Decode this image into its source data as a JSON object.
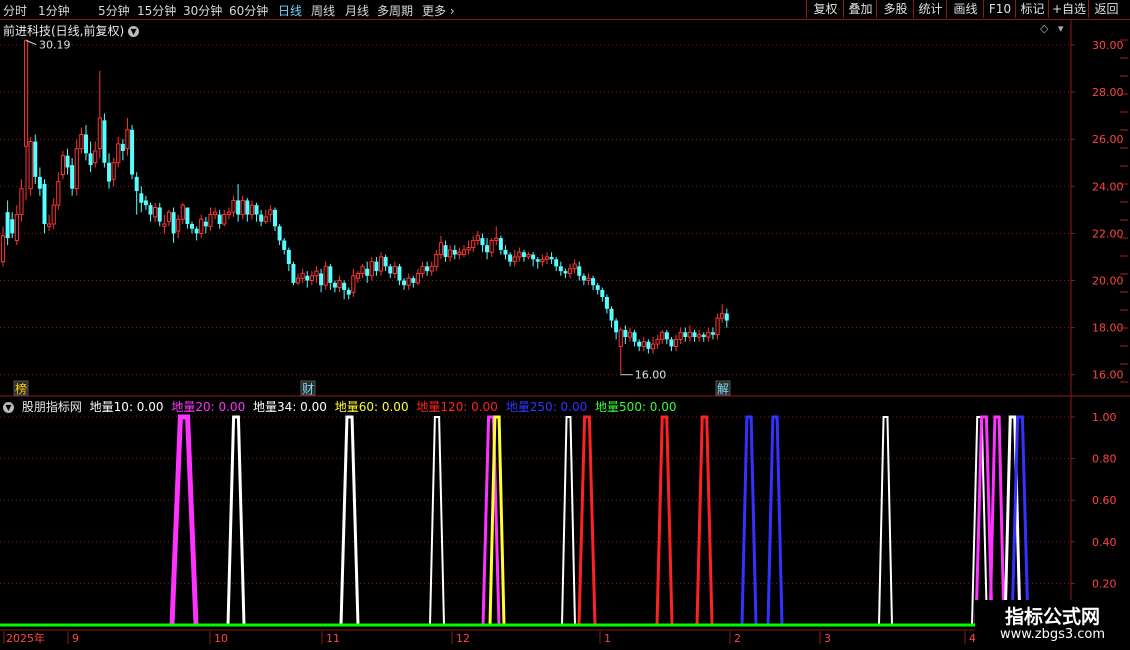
{
  "toolbar": {
    "periods": [
      "分时",
      "1分钟",
      "5分钟",
      "15分钟",
      "30分钟",
      "60分钟",
      "日线",
      "周线",
      "月线",
      "多周期",
      "更多"
    ],
    "active_period": "日线",
    "more_arrow": "chevron-right-icon",
    "right_buttons": [
      "复权",
      "叠加",
      "多股",
      "统计",
      "画线",
      "F10",
      "标记",
      "+自选",
      "返回"
    ]
  },
  "stock": {
    "title": "前进科技(日线,前复权)",
    "high_label": "30.19",
    "low_label": "16.00"
  },
  "events": [
    "榜",
    "财",
    "解"
  ],
  "price_axis": [
    "30.00",
    "28.00",
    "26.00",
    "24.00",
    "22.00",
    "20.00",
    "18.00",
    "16.00"
  ],
  "indicator": {
    "name": "股朋指标网",
    "series": [
      {
        "label": "地量10: 0.00",
        "color": "#ffffff"
      },
      {
        "label": "地量20: 0.00",
        "color": "#ff33ff"
      },
      {
        "label": "地量34: 0.00",
        "color": "#ffffff"
      },
      {
        "label": "地量60: 0.00",
        "color": "#ffff33"
      },
      {
        "label": "地量120: 0.00",
        "color": "#ff2222"
      },
      {
        "label": "地量250: 0.00",
        "color": "#3333ff"
      },
      {
        "label": "地量500: 0.00",
        "color": "#33ff33"
      }
    ],
    "axis": [
      "1.00",
      "0.80",
      "0.60",
      "0.40",
      "0.20"
    ]
  },
  "time_axis": [
    "2025年",
    "9",
    "10",
    "11",
    "12",
    "1",
    "2",
    "3",
    "4"
  ],
  "watermark": {
    "line1": "指标公式网",
    "line2": "www.zbgs3.com"
  },
  "colors": {
    "up": "#ff3333",
    "down": "#55ffff",
    "grid": "#8b1a1a",
    "base": "#00ff00"
  },
  "chart_data": {
    "type": "candlestick",
    "candles": [
      [
        20.8,
        21.9,
        20.6,
        22.3
      ],
      [
        22.9,
        21.8,
        21.5,
        23.4
      ],
      [
        22.6,
        22.0,
        21.8,
        22.9
      ],
      [
        21.7,
        22.8,
        21.5,
        23.2
      ],
      [
        22.8,
        23.9,
        22.5,
        24.3
      ],
      [
        25.7,
        30.2,
        23.4,
        30.19
      ],
      [
        23.9,
        25.9,
        23.6,
        26.1
      ],
      [
        25.9,
        24.4,
        24.1,
        26.2
      ],
      [
        24.4,
        23.9,
        23.6,
        24.8
      ],
      [
        24.1,
        22.4,
        22.0,
        24.3
      ],
      [
        22.3,
        22.4,
        22.1,
        22.8
      ],
      [
        22.4,
        23.2,
        22.2,
        23.5
      ],
      [
        23.2,
        24.2,
        23.0,
        24.6
      ],
      [
        24.5,
        25.3,
        24.3,
        25.5
      ],
      [
        25.3,
        24.8,
        24.5,
        25.6
      ],
      [
        24.9,
        23.9,
        23.6,
        25.2
      ],
      [
        23.9,
        25.6,
        23.6,
        26.0
      ],
      [
        25.6,
        26.2,
        25.4,
        26.5
      ],
      [
        26.2,
        25.4,
        25.1,
        26.6
      ],
      [
        25.4,
        24.9,
        24.6,
        25.9
      ],
      [
        25.0,
        25.5,
        24.8,
        25.9
      ],
      [
        25.6,
        26.9,
        25.2,
        28.9
      ],
      [
        26.8,
        25.0,
        24.8,
        27.1
      ],
      [
        25.0,
        24.2,
        23.9,
        25.4
      ],
      [
        24.3,
        25.0,
        24.0,
        25.2
      ],
      [
        25.0,
        25.8,
        24.8,
        26.1
      ],
      [
        25.8,
        25.5,
        25.1,
        26.0
      ],
      [
        25.6,
        26.4,
        25.3,
        26.9
      ],
      [
        26.4,
        24.5,
        24.3,
        26.6
      ],
      [
        24.4,
        23.8,
        22.8,
        24.6
      ],
      [
        23.7,
        23.3,
        22.9,
        24.0
      ],
      [
        23.4,
        23.2,
        23.0,
        23.6
      ],
      [
        23.2,
        22.8,
        22.5,
        23.3
      ],
      [
        22.7,
        23.1,
        22.5,
        23.3
      ],
      [
        23.1,
        22.5,
        22.3,
        23.3
      ],
      [
        22.3,
        22.4,
        22.0,
        22.8
      ],
      [
        22.5,
        22.9,
        22.3,
        23.0
      ],
      [
        22.9,
        22.0,
        21.6,
        23.1
      ],
      [
        22.1,
        22.6,
        21.8,
        22.8
      ],
      [
        22.6,
        23.2,
        22.4,
        23.3
      ],
      [
        23.1,
        22.4,
        22.2,
        23.1
      ],
      [
        22.4,
        22.2,
        22.0,
        22.5
      ],
      [
        22.2,
        22.0,
        21.7,
        22.3
      ],
      [
        22.0,
        22.6,
        21.8,
        22.8
      ],
      [
        22.5,
        22.3,
        22.0,
        22.7
      ],
      [
        22.3,
        22.8,
        22.1,
        23.1
      ],
      [
        22.8,
        22.9,
        22.6,
        23.1
      ],
      [
        22.8,
        22.4,
        22.2,
        23.0
      ],
      [
        22.4,
        22.8,
        22.3,
        23.0
      ],
      [
        22.8,
        22.9,
        22.6,
        23.1
      ],
      [
        22.9,
        23.4,
        22.7,
        23.6
      ],
      [
        23.4,
        22.8,
        22.5,
        24.1
      ],
      [
        22.8,
        23.4,
        22.6,
        23.6
      ],
      [
        23.4,
        22.8,
        22.5,
        23.5
      ],
      [
        22.8,
        23.2,
        22.6,
        23.4
      ],
      [
        23.2,
        22.8,
        22.5,
        23.3
      ],
      [
        22.8,
        22.5,
        22.3,
        23.0
      ],
      [
        22.5,
        22.7,
        22.4,
        23.0
      ],
      [
        22.8,
        23.0,
        22.5,
        23.2
      ],
      [
        23.0,
        22.3,
        22.1,
        23.1
      ],
      [
        22.3,
        21.7,
        21.5,
        22.4
      ],
      [
        21.7,
        21.3,
        21.1,
        21.8
      ],
      [
        21.3,
        20.7,
        20.4,
        21.4
      ],
      [
        20.7,
        19.9,
        19.8,
        20.8
      ],
      [
        19.9,
        20.1,
        19.8,
        20.3
      ],
      [
        20.1,
        20.3,
        19.9,
        20.5
      ],
      [
        20.2,
        20.0,
        19.7,
        20.4
      ],
      [
        20.0,
        20.2,
        19.8,
        20.4
      ],
      [
        20.2,
        20.4,
        19.9,
        20.6
      ],
      [
        20.3,
        19.8,
        19.5,
        20.5
      ],
      [
        19.8,
        20.6,
        19.6,
        20.8
      ],
      [
        20.6,
        19.9,
        19.6,
        20.7
      ],
      [
        19.9,
        19.7,
        19.5,
        20.0
      ],
      [
        19.7,
        20.0,
        19.5,
        20.2
      ],
      [
        19.9,
        19.6,
        19.2,
        20.0
      ],
      [
        19.6,
        19.4,
        19.2,
        19.7
      ],
      [
        19.5,
        20.2,
        19.3,
        20.5
      ],
      [
        20.1,
        20.3,
        19.9,
        20.4
      ],
      [
        20.3,
        20.6,
        20.1,
        20.7
      ],
      [
        20.5,
        20.2,
        19.9,
        20.8
      ],
      [
        20.2,
        20.8,
        20.0,
        21.0
      ],
      [
        20.8,
        20.4,
        20.2,
        21.0
      ],
      [
        20.4,
        21.0,
        20.2,
        21.2
      ],
      [
        21.0,
        20.6,
        20.4,
        21.1
      ],
      [
        20.6,
        20.3,
        20.1,
        20.7
      ],
      [
        20.3,
        20.6,
        20.1,
        20.8
      ],
      [
        20.6,
        20.0,
        19.8,
        20.7
      ],
      [
        20.0,
        19.8,
        19.6,
        20.1
      ],
      [
        19.8,
        20.1,
        19.6,
        20.3
      ],
      [
        20.1,
        19.9,
        19.7,
        20.2
      ],
      [
        19.9,
        20.3,
        19.8,
        20.5
      ],
      [
        20.3,
        20.6,
        20.1,
        20.8
      ],
      [
        20.6,
        20.4,
        20.2,
        20.8
      ],
      [
        20.4,
        20.6,
        20.2,
        20.8
      ],
      [
        20.6,
        21.1,
        20.4,
        21.3
      ],
      [
        21.1,
        21.6,
        20.9,
        21.9
      ],
      [
        21.5,
        21.0,
        20.8,
        21.7
      ],
      [
        21.0,
        21.3,
        20.8,
        21.5
      ],
      [
        21.3,
        21.1,
        20.9,
        21.5
      ],
      [
        21.1,
        21.2,
        20.9,
        21.4
      ],
      [
        21.1,
        21.3,
        21.0,
        21.5
      ],
      [
        21.3,
        21.4,
        21.1,
        21.7
      ],
      [
        21.4,
        21.7,
        21.2,
        21.9
      ],
      [
        21.7,
        21.9,
        21.5,
        22.1
      ],
      [
        21.8,
        21.5,
        21.2,
        22.0
      ],
      [
        21.5,
        21.2,
        20.9,
        21.8
      ],
      [
        21.2,
        21.7,
        21.0,
        21.8
      ],
      [
        21.7,
        21.8,
        21.5,
        22.3
      ],
      [
        21.8,
        21.3,
        21.1,
        21.9
      ],
      [
        21.3,
        21.1,
        20.9,
        21.5
      ],
      [
        21.1,
        20.8,
        20.6,
        21.2
      ],
      [
        20.8,
        21.0,
        20.6,
        21.3
      ],
      [
        21.0,
        21.2,
        20.8,
        21.4
      ],
      [
        21.2,
        21.0,
        20.8,
        21.3
      ],
      [
        21.0,
        21.1,
        20.9,
        21.2
      ],
      [
        21.1,
        20.9,
        20.6,
        21.2
      ],
      [
        20.9,
        20.8,
        20.5,
        21.0
      ],
      [
        20.8,
        20.9,
        20.6,
        21.1
      ],
      [
        20.9,
        21.0,
        20.7,
        21.2
      ],
      [
        21.0,
        20.9,
        20.7,
        21.2
      ],
      [
        20.9,
        20.6,
        20.4,
        21.0
      ],
      [
        20.6,
        20.4,
        20.2,
        20.8
      ],
      [
        20.4,
        20.3,
        20.1,
        20.5
      ],
      [
        20.3,
        20.5,
        20.1,
        20.7
      ],
      [
        20.5,
        20.7,
        20.3,
        20.9
      ],
      [
        20.6,
        20.2,
        20.0,
        20.8
      ],
      [
        20.2,
        20.0,
        19.8,
        20.3
      ],
      [
        20.0,
        20.1,
        19.8,
        20.3
      ],
      [
        20.1,
        19.8,
        19.6,
        20.2
      ],
      [
        19.8,
        19.6,
        19.4,
        19.9
      ],
      [
        19.6,
        19.3,
        19.1,
        19.7
      ],
      [
        19.3,
        18.8,
        18.6,
        19.4
      ],
      [
        18.8,
        18.3,
        18.0,
        18.9
      ],
      [
        18.3,
        17.8,
        17.5,
        18.4
      ],
      [
        17.2,
        17.9,
        16.0,
        18.0
      ],
      [
        17.9,
        17.6,
        17.3,
        18.1
      ],
      [
        17.6,
        17.8,
        17.4,
        18.0
      ],
      [
        17.8,
        17.4,
        17.2,
        17.9
      ],
      [
        17.4,
        17.2,
        17.0,
        17.5
      ],
      [
        17.2,
        17.4,
        17.0,
        17.6
      ],
      [
        17.4,
        17.1,
        16.9,
        17.5
      ],
      [
        17.1,
        17.3,
        16.9,
        17.6
      ],
      [
        17.3,
        17.5,
        17.1,
        17.7
      ],
      [
        17.5,
        17.8,
        17.3,
        17.9
      ],
      [
        17.8,
        17.5,
        17.3,
        17.9
      ],
      [
        17.5,
        17.2,
        17.0,
        17.6
      ],
      [
        17.2,
        17.5,
        17.0,
        17.7
      ],
      [
        17.5,
        17.8,
        17.3,
        18.0
      ],
      [
        17.8,
        17.6,
        17.4,
        18.0
      ],
      [
        17.6,
        17.8,
        17.4,
        18.1
      ],
      [
        17.8,
        17.6,
        17.4,
        17.9
      ],
      [
        17.6,
        17.7,
        17.4,
        17.9
      ],
      [
        17.7,
        17.6,
        17.4,
        17.8
      ],
      [
        17.6,
        17.8,
        17.4,
        18.0
      ],
      [
        17.8,
        17.7,
        17.5,
        18.0
      ],
      [
        17.7,
        18.4,
        17.5,
        18.6
      ],
      [
        18.4,
        18.6,
        18.2,
        19.0
      ],
      [
        18.6,
        18.3,
        18.0,
        18.8
      ]
    ]
  }
}
